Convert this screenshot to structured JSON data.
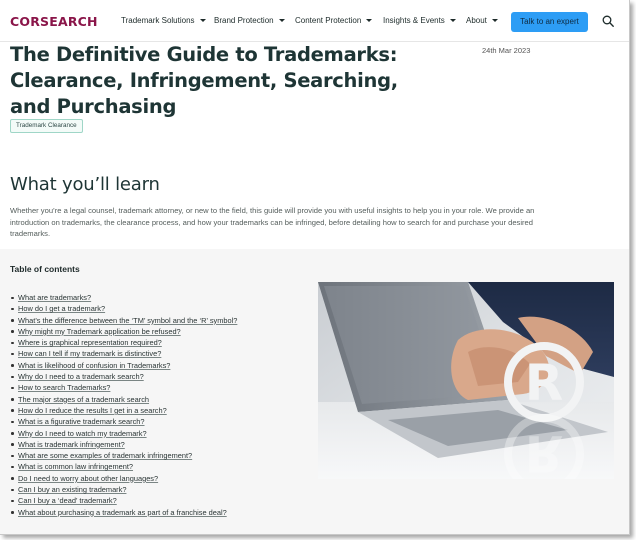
{
  "nav": {
    "logo": "CORSEARCH",
    "items": [
      {
        "label": "Trademark Solutions"
      },
      {
        "label": "Brand Protection"
      },
      {
        "label": "Content Protection"
      },
      {
        "label": "Insights & Events"
      },
      {
        "label": "About"
      }
    ],
    "cta_label": "Talk to an expert",
    "search_icon": "search-icon"
  },
  "article": {
    "title": "The Definitive Guide to Trademarks: Clearance, Infringement, Searching, and Purchasing",
    "date": "24th Mar 2023",
    "tag": "Trademark Clearance",
    "learn_heading": "What you’ll learn",
    "intro": "Whether you’re a legal counsel, trademark attorney, or new to the field, this guide will provide you with useful insights to help you in your role. We provide an introduction on trademarks, the clearance process, and how your trademarks can be infringed, before detailing how to search for and purchase your desired trademarks."
  },
  "toc": {
    "heading": "Table of contents",
    "items": [
      "What are trademarks?",
      "How do I get a trademark?",
      "What’s the difference between the ‘TM’ symbol and the ‘R’ symbol?",
      "Why might my Trademark application be refused?",
      "Where is graphical representation required?",
      "How can I tell if my trademark is distinctive?",
      "What is likelihood of confusion in Trademarks?",
      "Why do I need to a trademark search?",
      "How to search Trademarks?",
      "The major stages of a trademark search",
      "How do I reduce the results I get in a search?",
      "What is a figurative trademark search?",
      "Why do I need to watch my trademark?",
      "What is trademark infringement?",
      "What are some examples of trademark infringement?",
      "What is common law infringement?",
      "Do I need to worry about other languages?",
      "Can I buy an existing trademark?",
      "Can I buy a ‘dead’ trademark?",
      "What about purchasing a trademark as part of a franchise deal?"
    ]
  },
  "colors": {
    "brand": "#8a1549",
    "cta": "#2d9df5",
    "heading": "#1e3535",
    "tag_border": "#9fd6c7"
  }
}
